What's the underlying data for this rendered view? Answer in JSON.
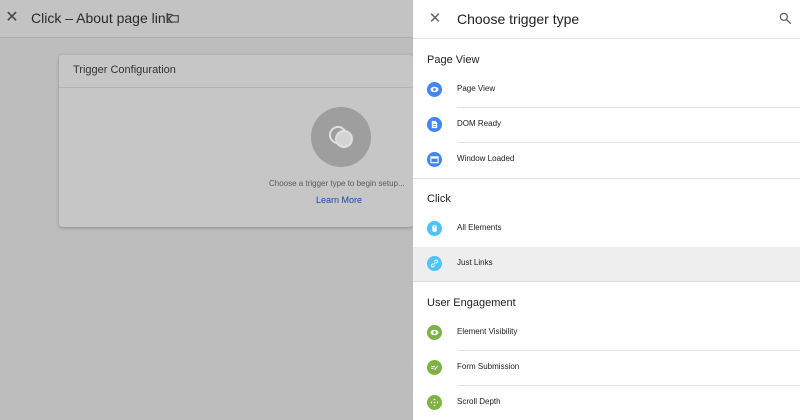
{
  "background": {
    "header_title": "Click – About page link",
    "card": {
      "title": "Trigger Configuration",
      "hint": "Choose a trigger type to begin setup...",
      "learn_more": "Learn More"
    }
  },
  "panel": {
    "title": "Choose trigger type",
    "sections": [
      {
        "title": "Page View",
        "items": [
          {
            "label": "Page View",
            "icon": "eye-icon",
            "color": "#4285f4"
          },
          {
            "label": "DOM Ready",
            "icon": "document-icon",
            "color": "#4285f4"
          },
          {
            "label": "Window Loaded",
            "icon": "window-icon",
            "color": "#4285f4"
          }
        ]
      },
      {
        "title": "Click",
        "items": [
          {
            "label": "All Elements",
            "icon": "mouse-icon",
            "color": "#4fc3f7"
          },
          {
            "label": "Just Links",
            "icon": "link-icon",
            "color": "#4fc3f7"
          }
        ]
      },
      {
        "title": "User Engagement",
        "items": [
          {
            "label": "Element Visibility",
            "icon": "eye-icon",
            "color": "#7cb342"
          },
          {
            "label": "Form Submission",
            "icon": "form-icon",
            "color": "#7cb342"
          },
          {
            "label": "Scroll Depth",
            "icon": "move-icon",
            "color": "#7cb342"
          }
        ]
      }
    ],
    "selected_item": "Just Links"
  }
}
